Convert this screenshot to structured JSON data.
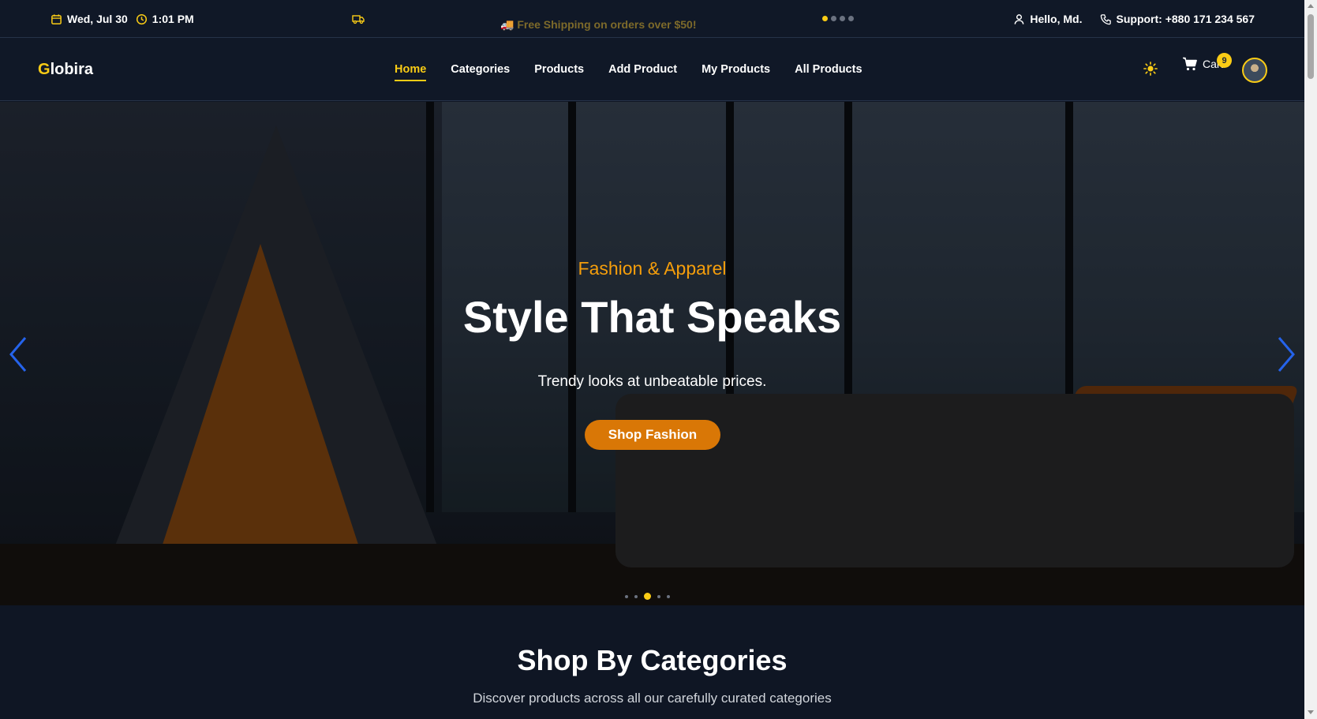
{
  "topbar": {
    "date": "Wed, Jul 30",
    "time": "1:01 PM",
    "promo": "🚚 Free Shipping on orders over $50!",
    "greeting": "Hello, Md.",
    "support": "Support: +880 171 234 567",
    "icons": [
      "calendar-icon",
      "clock-icon",
      "truck-icon",
      "user-icon",
      "phone-icon"
    ]
  },
  "brand": {
    "first_letter": "G",
    "rest": "lobira"
  },
  "nav": {
    "items": [
      "Home",
      "Categories",
      "Products",
      "Add Product",
      "My Products",
      "All Products"
    ],
    "active": "Home"
  },
  "cart": {
    "label": "Cart",
    "count": "9"
  },
  "hero": {
    "subtitle": "Fashion & Apparel",
    "title": "Style That Speaks",
    "description": "Trendy looks at unbeatable prices.",
    "button": "Shop Fashion"
  },
  "categories": {
    "title": "Shop By Categories",
    "description": "Discover products across all our carefully curated categories"
  },
  "colors": {
    "accent": "#facc15",
    "button": "#d97706",
    "subtitle": "#f59e0b",
    "background": "#0f1624",
    "arrow": "#2563eb"
  }
}
